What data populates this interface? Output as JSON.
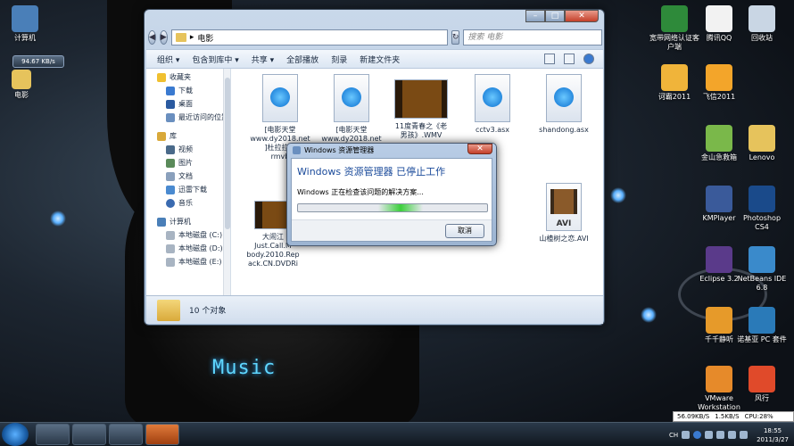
{
  "desktop": {
    "bg_text": "Music",
    "left_icons": [
      {
        "name": "computer",
        "label": "计算机",
        "color": "#4a7fb8"
      },
      {
        "name": "movies",
        "label": "电影",
        "color": "#e6c35c"
      }
    ],
    "speed_gadget": "94.67 KB/s",
    "right_icons": [
      {
        "label": "宽带网络认证客户端",
        "color": "#2e8a3a"
      },
      {
        "label": "腾讯QQ",
        "color": "#f2f2f2"
      },
      {
        "label": "回收站",
        "color": "#c9d6e4"
      },
      {
        "label": "诃霸2011",
        "color": "#f0b43a"
      },
      {
        "label": "飞信2011",
        "color": "#f3a52a"
      },
      {
        "label": "金山急救箱",
        "color": "#7ab84a"
      },
      {
        "label": "Lenovo",
        "color": "#e6c35c"
      },
      {
        "label": "KMPlayer",
        "color": "#3a5a9a"
      },
      {
        "label": "Photoshop CS4",
        "color": "#1a4a8a"
      },
      {
        "label": "Eclipse 3.2",
        "color": "#5a3a8a"
      },
      {
        "label": "NetBeans IDE 6.8",
        "color": "#3a8acb"
      },
      {
        "label": "千千静听",
        "color": "#e69a2a"
      },
      {
        "label": "诺基亚 PC 套件",
        "color": "#2a7ab8"
      },
      {
        "label": "VMware Workstation",
        "color": "#e68a2a"
      },
      {
        "label": "风行",
        "color": "#e04a2a"
      }
    ]
  },
  "explorer": {
    "address": "电影",
    "address_arrow": "▸",
    "search_placeholder": "搜索 电影",
    "toolbar": {
      "organize": "组织 ▾",
      "include": "包含到库中 ▾",
      "share": "共享 ▾",
      "play_all": "全部播放",
      "burn": "刻录",
      "new_folder": "新建文件夹"
    },
    "sidebar": {
      "favorites": "收藏夹",
      "favorites_items": [
        "下载",
        "桌面",
        "最近访问的位置"
      ],
      "library": "库",
      "library_items": [
        "视频",
        "图片",
        "文档",
        "迅雷下载",
        "音乐"
      ],
      "computer": "计算机",
      "computer_items": [
        "本地磁盘 (C:)",
        "本地磁盘 (D:)",
        "本地磁盘 (E:)"
      ]
    },
    "files": [
      {
        "name": "[电影天堂www.dy2018.net]杜拉拉升职记.rmvb",
        "display": "[电影天堂\nwww.dy2018.net\n]杜拉拉升\nrmvb",
        "kind": "media"
      },
      {
        "name": "[电影天堂www.dy2018.net]",
        "display": "[电影天堂\nwww.dy2018.net\n]",
        "kind": "media"
      },
      {
        "name": "11度青春之《老男孩》.WMV",
        "display": "11度青春之《老\n男孩》.WMV",
        "kind": "video"
      },
      {
        "name": "cctv3.asx",
        "display": "cctv3.asx",
        "kind": "media"
      },
      {
        "name": "shandong.asx",
        "display": "shandong.asx",
        "kind": "media"
      },
      {
        "name": "大闹天宫 Just.Call.Me.Nobody.2010.Repack.CN.DVDRip",
        "display": "大闹江\nJust.Call.M\nbody.2010.Rep\nack.CN.DVDRi",
        "kind": "video"
      },
      {
        "name": "mkv",
        "display": "mkv",
        "kind": "media"
      },
      {
        "name": "山楂树之恋.AVI",
        "display": "山楂树之恋.AVI",
        "kind": "avi"
      }
    ],
    "status": "10 个对象"
  },
  "dialog": {
    "title": "Windows 资源管理器",
    "heading": "Windows 资源管理器 已停止工作",
    "message": "Windows 正在检查该问题的解决方案...",
    "cancel": "取消",
    "progress": 0.5
  },
  "taskbar": {
    "tray_lang": "CH",
    "time": "18:55",
    "date": "2011/3/27",
    "net_down": "56.09KB/S",
    "net_up": "1.5KB/S",
    "cpu": "CPU:28%"
  }
}
